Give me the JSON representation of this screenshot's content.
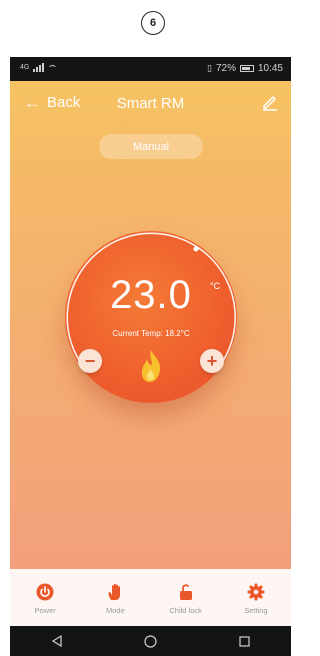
{
  "step_badge": "6",
  "status_bar": {
    "carrier": "4G",
    "battery_percent": "72%",
    "time": "10:45"
  },
  "header": {
    "back_label": "Back",
    "title": "Smart RM",
    "icons": {
      "back": "left-arrow-icon",
      "edit": "pencil-icon"
    }
  },
  "mode": {
    "label": "Manual"
  },
  "thermostat": {
    "setpoint": "23.0",
    "unit": "°C",
    "current_temp_label": "Current Temp: 18.2°C",
    "controls": {
      "decrease": "−",
      "increase": "+"
    },
    "heating_icon": "flame-icon"
  },
  "bottom_tabs": [
    {
      "label": "Power",
      "icon": "power-icon"
    },
    {
      "label": "Mode",
      "icon": "hand-icon"
    },
    {
      "label": "Child lock",
      "icon": "unlock-icon"
    },
    {
      "label": "Setting",
      "icon": "gear-icon"
    }
  ],
  "colors": {
    "accent": "#e9582b",
    "gradient_top": "#f6c560",
    "gradient_bottom": "#f29c7e",
    "tab_icon": "#e9582b"
  }
}
